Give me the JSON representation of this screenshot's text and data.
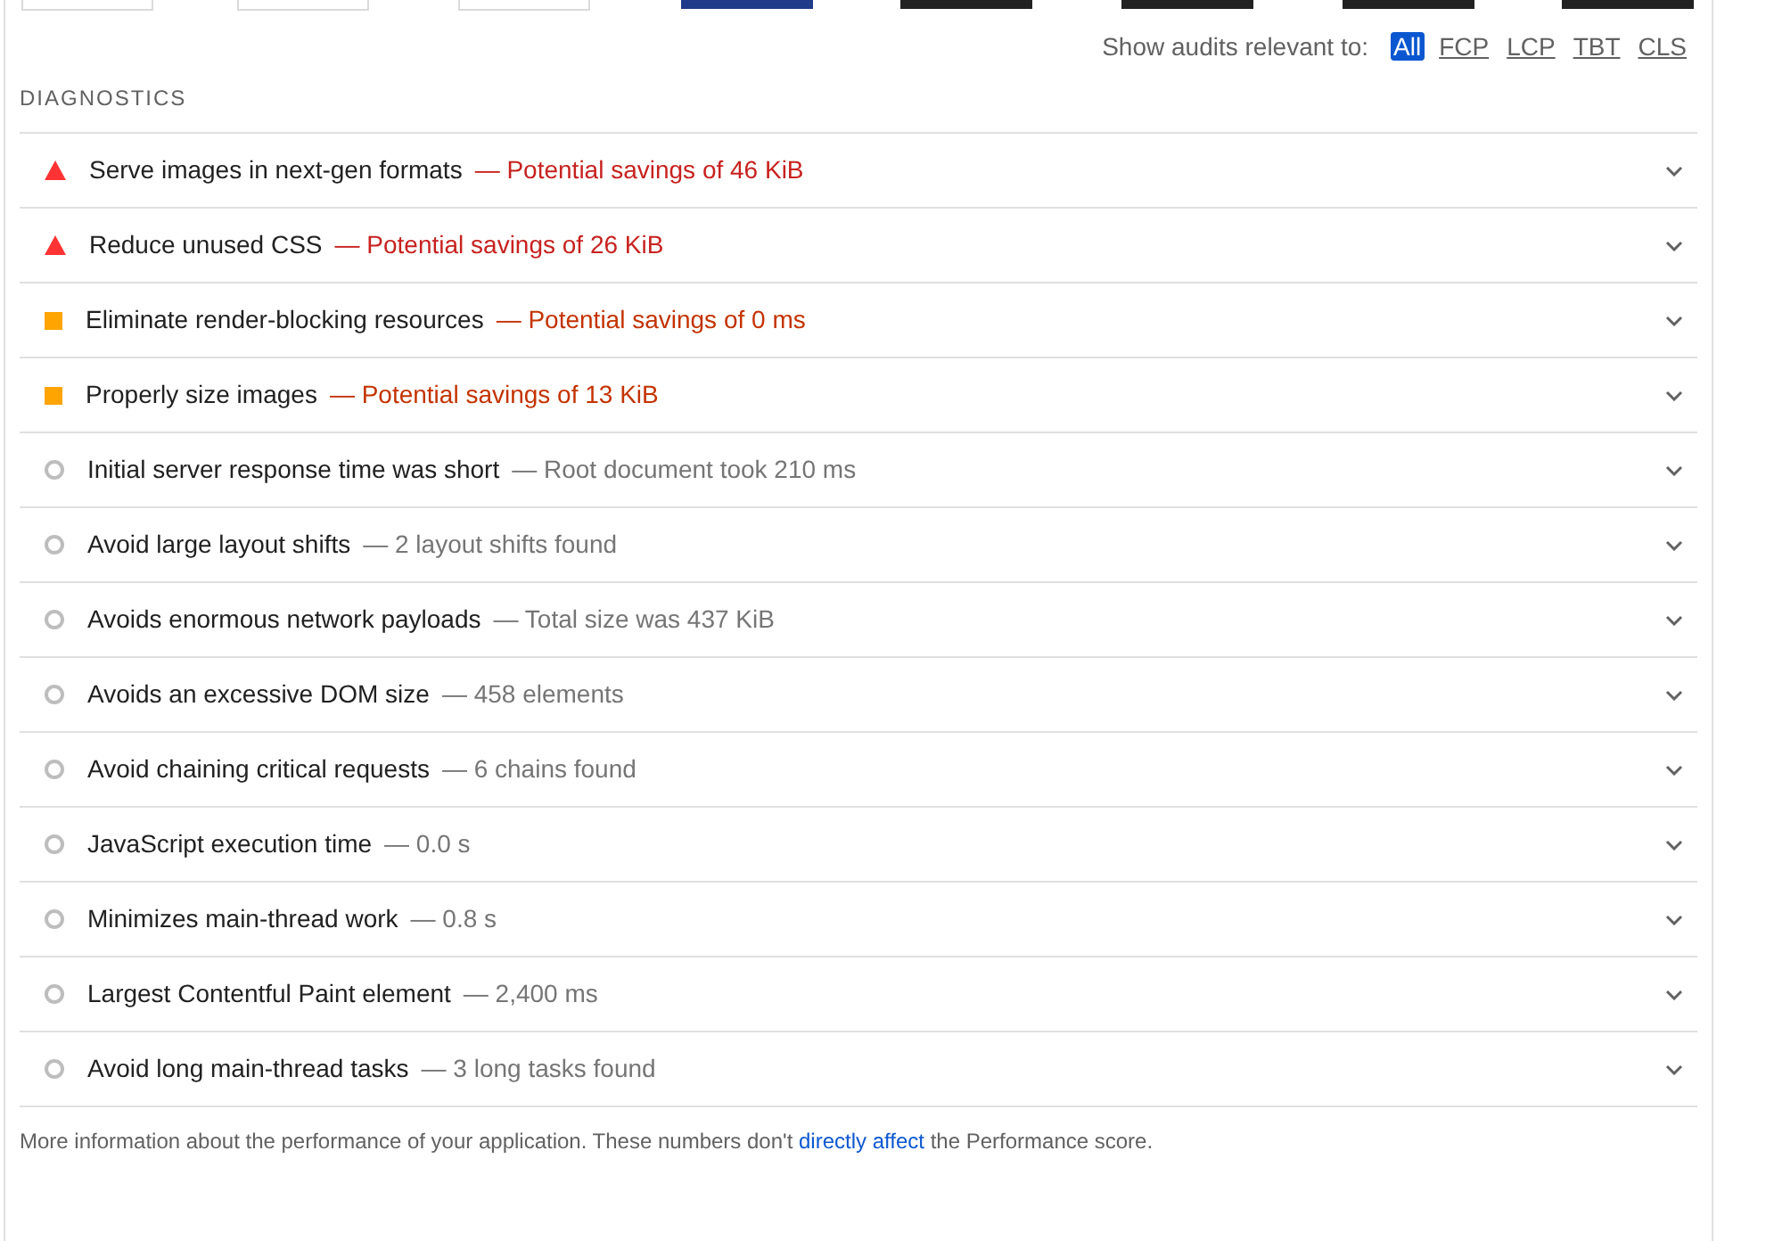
{
  "filter": {
    "label": "Show audits relevant to:",
    "chips": [
      {
        "label": "All",
        "selected": true
      },
      {
        "label": "FCP",
        "selected": false
      },
      {
        "label": "LCP",
        "selected": false
      },
      {
        "label": "TBT",
        "selected": false
      },
      {
        "label": "CLS",
        "selected": false
      }
    ]
  },
  "section_title": "DIAGNOSTICS",
  "audits": [
    {
      "kind": "fail",
      "title": "Serve images in next-gen formats",
      "detail": "— Potential savings of 46 KiB"
    },
    {
      "kind": "fail",
      "title": "Reduce unused CSS",
      "detail": "— Potential savings of 26 KiB"
    },
    {
      "kind": "average",
      "title": "Eliminate render-blocking resources",
      "detail": "— Potential savings of 0 ms"
    },
    {
      "kind": "average",
      "title": "Properly size images",
      "detail": "— Potential savings of 13 KiB"
    },
    {
      "kind": "pass",
      "title": "Initial server response time was short",
      "detail": "— Root document took 210 ms"
    },
    {
      "kind": "pass",
      "title": "Avoid large layout shifts",
      "detail": "— 2 layout shifts found"
    },
    {
      "kind": "pass",
      "title": "Avoids enormous network payloads",
      "detail": "— Total size was 437 KiB"
    },
    {
      "kind": "pass",
      "title": "Avoids an excessive DOM size",
      "detail": "— 458 elements"
    },
    {
      "kind": "pass",
      "title": "Avoid chaining critical requests",
      "detail": "— 6 chains found"
    },
    {
      "kind": "pass",
      "title": "JavaScript execution time",
      "detail": "— 0.0 s"
    },
    {
      "kind": "pass",
      "title": "Minimizes main-thread work",
      "detail": "— 0.8 s"
    },
    {
      "kind": "pass",
      "title": "Largest Contentful Paint element",
      "detail": "— 2,400 ms"
    },
    {
      "kind": "pass",
      "title": "Avoid long main-thread tasks",
      "detail": "— 3 long tasks found"
    }
  ],
  "note": {
    "before": "More information about the performance of your application. These numbers don't",
    "link": "directly affect",
    "after": "the Performance score."
  }
}
